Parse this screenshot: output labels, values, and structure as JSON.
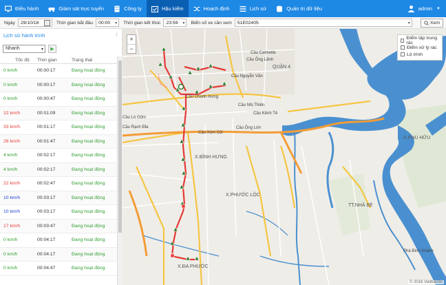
{
  "nav": {
    "items": [
      {
        "label": "Điều hành",
        "icon": "monitor-icon"
      },
      {
        "label": "Giám sát trực tuyến",
        "icon": "car-icon"
      },
      {
        "label": "Công ty",
        "icon": "building-icon"
      },
      {
        "label": "Hậu kiểm",
        "icon": "calendar-check-icon"
      },
      {
        "label": "Hoạch định",
        "icon": "shuffle-icon"
      },
      {
        "label": "Lịch sử",
        "icon": "list-icon"
      },
      {
        "label": "Quản trị dữ liệu",
        "icon": "database-icon"
      }
    ],
    "active_index": 3,
    "user": "admin"
  },
  "filters": {
    "date_label": "Ngày",
    "date_value": "29/10/18",
    "start_label": "Thời gian bắt đầu",
    "start_value": "00:00",
    "end_label": "Thời gian kết thúc",
    "end_value": "23:59",
    "plate_label": "Biển số xe cần xem",
    "plate_value": "51E02405",
    "view_button": "Xem"
  },
  "panel": {
    "title": "Lịch sử hành trình",
    "speed_option": "Nhanh",
    "columns": [
      "Tốc độ",
      "Thời gian",
      "Trạng thái"
    ],
    "rows": [
      {
        "speed": "0 km/h",
        "time": "00:00:17",
        "status": "Đang hoạt động",
        "color": "#2e9e2e"
      },
      {
        "speed": "0 km/h",
        "time": "00:00:17",
        "status": "Đang hoạt động",
        "color": "#2e9e2e"
      },
      {
        "speed": "0 km/h",
        "time": "00:00:47",
        "status": "Đang hoạt động",
        "color": "#2e9e2e"
      },
      {
        "speed": "22 km/h",
        "time": "00:01:09",
        "status": "Đang hoạt động",
        "color": "#e53935"
      },
      {
        "speed": "33 km/h",
        "time": "00:01:17",
        "status": "Đang hoạt động",
        "color": "#e53935"
      },
      {
        "speed": "26 km/h",
        "time": "00:01:47",
        "status": "Đang hoạt động",
        "color": "#e53935"
      },
      {
        "speed": "4 km/h",
        "time": "00:02:17",
        "status": "Đang hoạt động",
        "color": "#2e9e2e"
      },
      {
        "speed": "4 km/h",
        "time": "00:02:17",
        "status": "Đang hoạt động",
        "color": "#2e9e2e"
      },
      {
        "speed": "22 km/h",
        "time": "00:02:47",
        "status": "Đang hoạt động",
        "color": "#e53935"
      },
      {
        "speed": "10 km/h",
        "time": "00:03:17",
        "status": "Đang hoạt động",
        "color": "#1e40d0"
      },
      {
        "speed": "10 km/h",
        "time": "00:03:17",
        "status": "Đang hoạt động",
        "color": "#1e40d0"
      },
      {
        "speed": "17 km/h",
        "time": "00:03:47",
        "status": "Đang hoạt động",
        "color": "#e53935"
      },
      {
        "speed": "0 km/h",
        "time": "00:04:17",
        "status": "Đang hoạt động",
        "color": "#2e9e2e"
      },
      {
        "speed": "0 km/h",
        "time": "00:04:17",
        "status": "Đang hoạt động",
        "color": "#2e9e2e"
      },
      {
        "speed": "0 km/h",
        "time": "00:04:47",
        "status": "Đang hoạt động",
        "color": "#2e9e2e"
      }
    ]
  },
  "map": {
    "zoom_in": "+",
    "zoom_out": "−",
    "layers": [
      "Điểm tập trung rác",
      "Điểm xử lý rác",
      "Lộ trình"
    ],
    "copyright": "© 2016 Vietbando",
    "labels": {
      "quan4": "QUẬN 4",
      "binh_hung": "X.BÌNH HƯNG",
      "phuoc_loc": "X.PHƯỚC LỘC",
      "da_phuoc": "X.ĐA PHƯỚC",
      "nha_be": "TT.NHÀ BÈ",
      "phu_huu": "X.PHÚ HỮU",
      "cau_nguyen_van": "Cầu Nguyễn Văn",
      "cau_calmette": "Cầu Calmette",
      "cau_ong_lanh": "Cầu Ông Lãnh",
      "cau_chanh_hung": "Cầu Chánh Hưng",
      "cau_nhi_thien": "Cầu Nhị Thiên",
      "cau_xom_cui": "Cầu Xóm Củi",
      "cau_ong_lon": "Cầu Ông Lớn",
      "cau_kenh_te": "Cầu Kênh Tẻ",
      "cau_lo_gom": "Cầu Lò Gốm",
      "cau_rach_dia": "Cầu Rạch Đỉa",
      "phu_xuan": "Phà Bình Khánh"
    },
    "colors": {
      "route": "#e53935",
      "marker": "#2e7d32",
      "water": "#4a90d0",
      "road": "#f5c542",
      "road_major": "#f39c36"
    }
  }
}
